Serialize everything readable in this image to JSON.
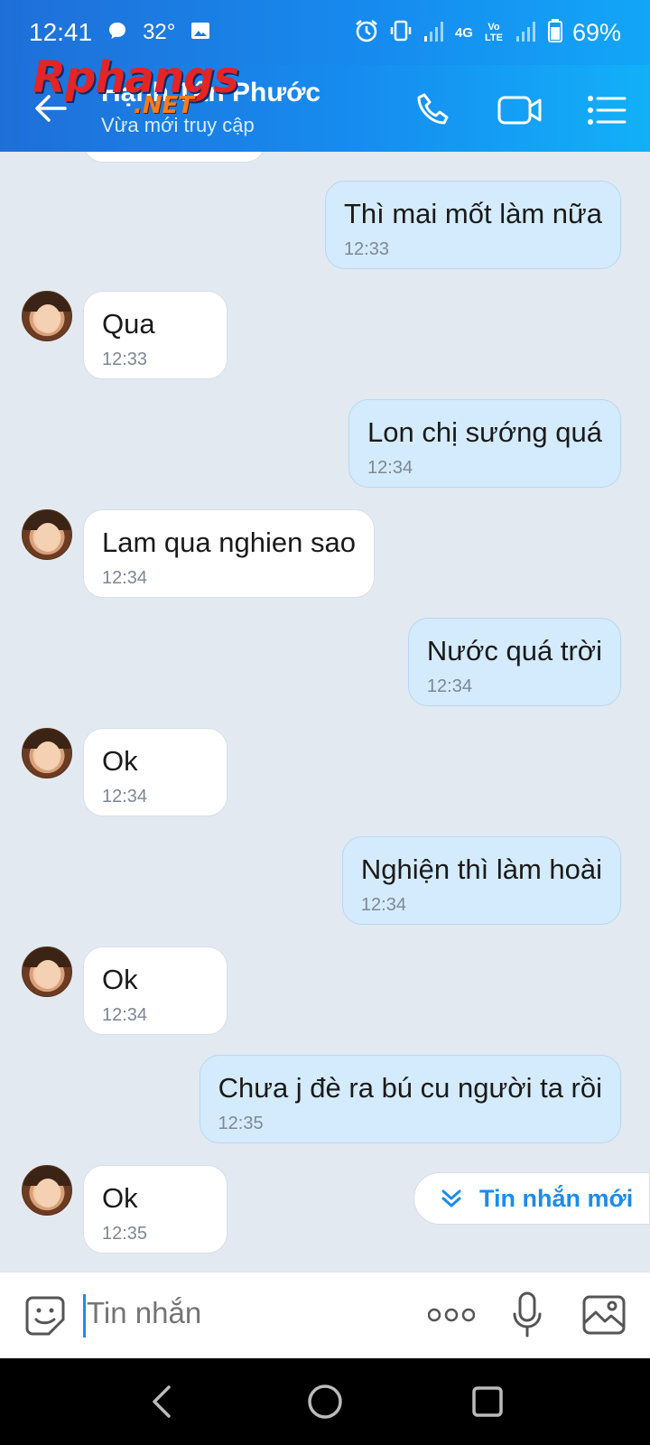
{
  "status_bar": {
    "time": "12:41",
    "temperature": "32°",
    "signal_label": "4G",
    "volte_label": "Vo LTE",
    "battery": "69%"
  },
  "header": {
    "watermark": "Rphangs",
    "watermark_suffix": ".NET",
    "contact_name": "Hạnh Tân Phước",
    "status": "Vừa mới truy cập"
  },
  "messages": [
    {
      "dir": "out",
      "text": "Thì mai mốt làm nữa",
      "time": "12:33"
    },
    {
      "dir": "in",
      "text": "Qua",
      "time": "12:33"
    },
    {
      "dir": "out",
      "text": "Lon chị sướng quá",
      "time": "12:34"
    },
    {
      "dir": "in",
      "text": "Lam  qua nghien sao",
      "time": "12:34"
    },
    {
      "dir": "out",
      "text": "Nước quá trời",
      "time": "12:34"
    },
    {
      "dir": "in",
      "text": "Ok",
      "time": "12:34"
    },
    {
      "dir": "out",
      "text": "Nghiện thì làm hoài",
      "time": "12:34"
    },
    {
      "dir": "in",
      "text": "Ok",
      "time": "12:34"
    },
    {
      "dir": "out",
      "text": "Chưa j đè ra bú cu người ta rồi",
      "time": "12:35"
    },
    {
      "dir": "in",
      "text": "Ok",
      "time": "12:35"
    }
  ],
  "new_messages_button": "Tin nhắn mới",
  "composer": {
    "placeholder": "Tin nhắn"
  },
  "colors": {
    "header_start": "#1f6fd8",
    "header_end": "#12b0f8",
    "accent": "#1a8cf0",
    "outgoing_bubble": "#d4ebfd",
    "background": "#e2e9f1"
  }
}
